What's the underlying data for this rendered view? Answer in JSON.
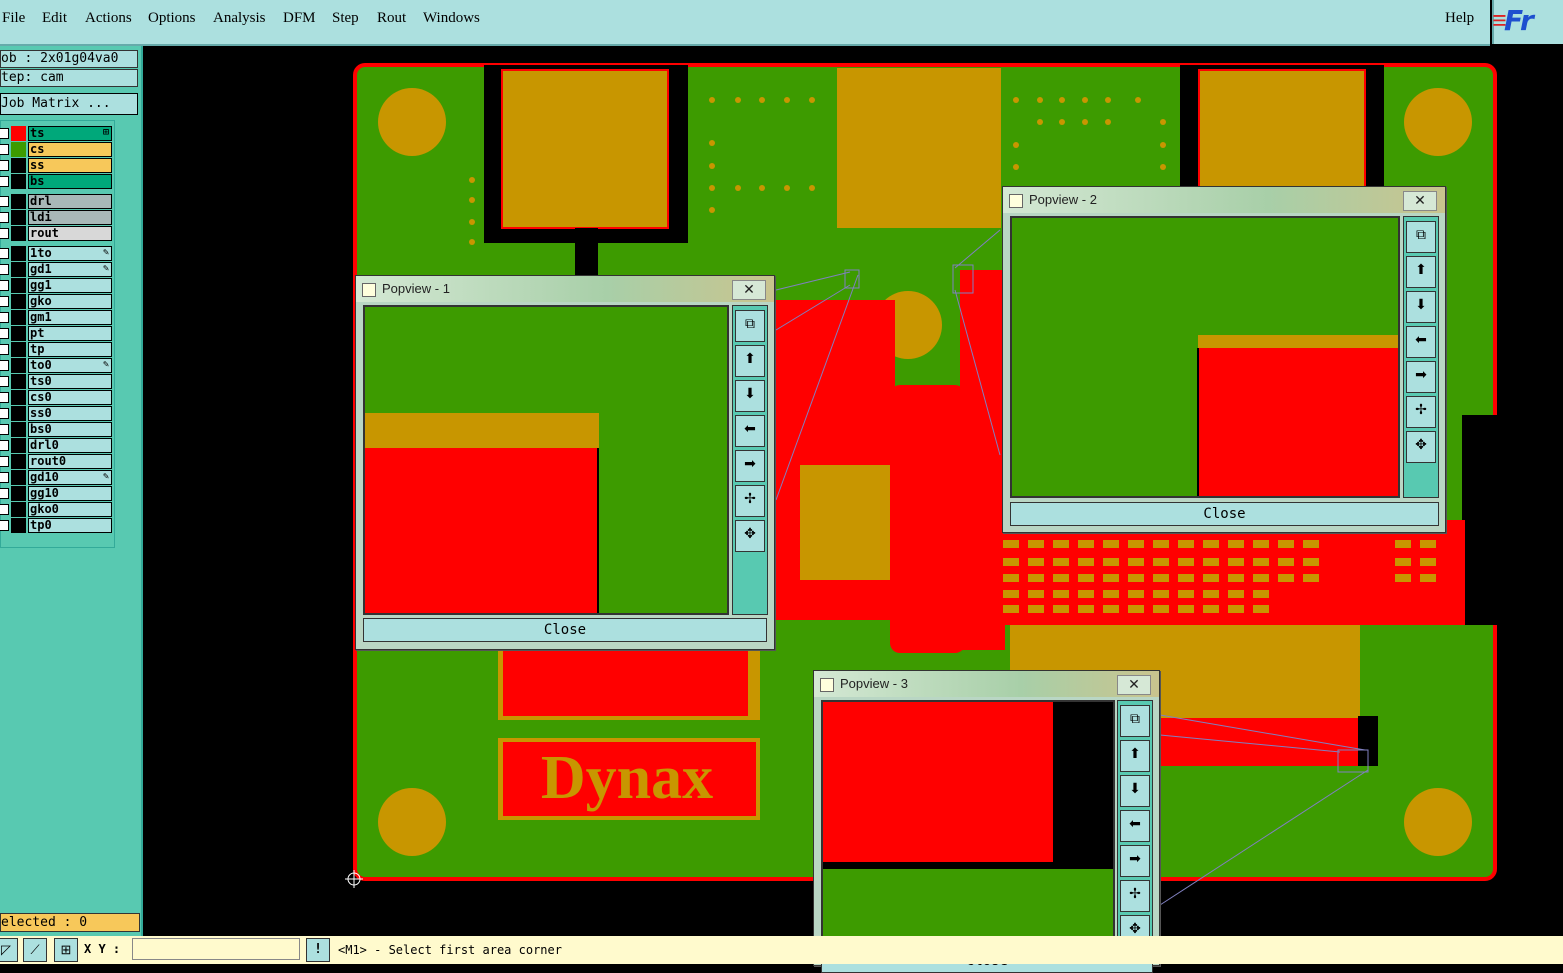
{
  "menu": {
    "items": [
      "File",
      "Edit",
      "Actions",
      "Options",
      "Analysis",
      "DFM",
      "Step",
      "Rout",
      "Windows"
    ],
    "help": "Help"
  },
  "logo": {
    "text": "Fr"
  },
  "left_panel": {
    "job": "ob : 2x01g04va0",
    "step": "tep: cam",
    "job_matrix": "Job Matrix ...",
    "layers": [
      {
        "name": "ts",
        "swatch": "#ff0000",
        "bg": "#00a87a",
        "flag": "⊞"
      },
      {
        "name": "cs",
        "swatch": "#3d9b00",
        "bg": "#f7c85a",
        "flag": ""
      },
      {
        "name": "ss",
        "swatch": "#000000",
        "bg": "#f7c85a",
        "flag": ""
      },
      {
        "name": "bs",
        "swatch": "#000000",
        "bg": "#00a87a",
        "flag": ""
      },
      {
        "name": "drl",
        "swatch": "#000000",
        "bg": "#a8b8b8",
        "flag": ""
      },
      {
        "name": "ldi",
        "swatch": "#000000",
        "bg": "#a8b8b8",
        "flag": ""
      },
      {
        "name": "rout",
        "swatch": "#000000",
        "bg": "#d8d8d8",
        "flag": ""
      },
      {
        "name": "1to",
        "swatch": "#000000",
        "bg": "#ace0df",
        "flag": "✎"
      },
      {
        "name": "gd1",
        "swatch": "#000000",
        "bg": "#ace0df",
        "flag": "✎"
      },
      {
        "name": "gg1",
        "swatch": "#000000",
        "bg": "#ace0df",
        "flag": ""
      },
      {
        "name": "gko",
        "swatch": "#000000",
        "bg": "#ace0df",
        "flag": ""
      },
      {
        "name": "gm1",
        "swatch": "#000000",
        "bg": "#ace0df",
        "flag": ""
      },
      {
        "name": "pt",
        "swatch": "#000000",
        "bg": "#ace0df",
        "flag": ""
      },
      {
        "name": "tp",
        "swatch": "#000000",
        "bg": "#ace0df",
        "flag": ""
      },
      {
        "name": "to0",
        "swatch": "#000000",
        "bg": "#ace0df",
        "flag": "✎"
      },
      {
        "name": "ts0",
        "swatch": "#000000",
        "bg": "#ace0df",
        "flag": ""
      },
      {
        "name": "cs0",
        "swatch": "#000000",
        "bg": "#ace0df",
        "flag": ""
      },
      {
        "name": "ss0",
        "swatch": "#000000",
        "bg": "#ace0df",
        "flag": ""
      },
      {
        "name": "bs0",
        "swatch": "#000000",
        "bg": "#ace0df",
        "flag": ""
      },
      {
        "name": "drl0",
        "swatch": "#000000",
        "bg": "#ace0df",
        "flag": ""
      },
      {
        "name": "rout0",
        "swatch": "#000000",
        "bg": "#ace0df",
        "flag": ""
      },
      {
        "name": "gd10",
        "swatch": "#000000",
        "bg": "#ace0df",
        "flag": "✎"
      },
      {
        "name": "gg10",
        "swatch": "#000000",
        "bg": "#ace0df",
        "flag": ""
      },
      {
        "name": "gko0",
        "swatch": "#000000",
        "bg": "#ace0df",
        "flag": ""
      },
      {
        "name": "tp0",
        "swatch": "#000000",
        "bg": "#ace0df",
        "flag": ""
      }
    ],
    "selected": "elected : 0"
  },
  "board": {
    "silkscreen_text": "Dynax"
  },
  "popviews": [
    {
      "title": "Popview - 1",
      "close_label": "Close"
    },
    {
      "title": "Popview - 2",
      "close_label": "Close"
    },
    {
      "title": "Popview - 3",
      "close_label": "Close"
    }
  ],
  "popview_tools": [
    "zoom-fit",
    "pan-up",
    "pan-down",
    "pan-left",
    "pan-right",
    "zoom-in",
    "zoom-out"
  ],
  "status": {
    "xy_label": "X Y :",
    "xy_value": "",
    "alert": "!",
    "prompt": "<M1> - Select first area corner"
  },
  "colors": {
    "copper": "#ff0000",
    "solder": "#3d9b00",
    "pad": "#c89600",
    "ui": "#ace0df",
    "panel": "#58c9b1"
  }
}
